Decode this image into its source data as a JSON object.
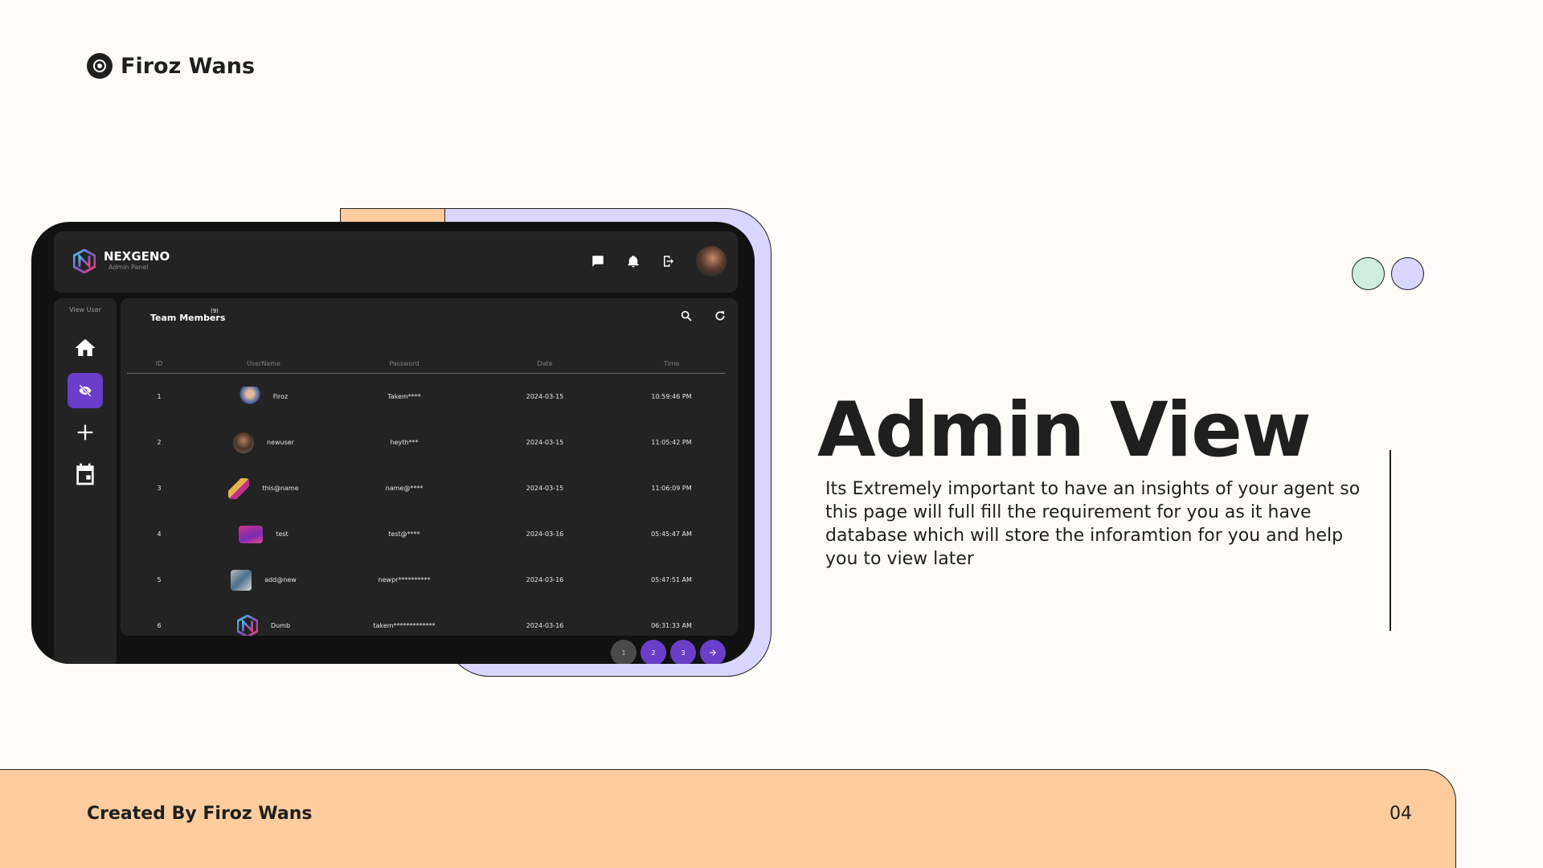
{
  "brand": {
    "name": "Firoz Wans"
  },
  "app": {
    "title": "NEXGENO",
    "subtitle": "Admin Panel",
    "sidebar": {
      "label": "View User"
    },
    "panel": {
      "title": "Team Members",
      "count": "(9)",
      "columns": [
        "ID",
        "UserName",
        "Password",
        "Date",
        "Time"
      ],
      "rows": [
        {
          "id": "1",
          "username": "Firoz",
          "password": "Takem****",
          "date": "2024-03-15",
          "time": "10:59:46 PM"
        },
        {
          "id": "2",
          "username": "newuser",
          "password": "heyth***",
          "date": "2024-03-15",
          "time": "11:05:42 PM"
        },
        {
          "id": "3",
          "username": "this@name",
          "password": "name@****",
          "date": "2024-03-15",
          "time": "11:06:09 PM"
        },
        {
          "id": "4",
          "username": "test",
          "password": "test@****",
          "date": "2024-03-16",
          "time": "05:45:47 AM"
        },
        {
          "id": "5",
          "username": "add@new",
          "password": "newpr**********",
          "date": "2024-03-16",
          "time": "05:47:51 AM"
        },
        {
          "id": "6",
          "username": "Dumb",
          "password": "takem*************",
          "date": "2024-03-16",
          "time": "06:31:33 AM"
        }
      ]
    },
    "pagination": [
      "1",
      "2",
      "3"
    ]
  },
  "slide": {
    "title": "Admin View",
    "description": "Its Extremely important to have an insights of your agent so this page will full fill the requirement for you as it have database which will store the inforamtion for you and help you to view later"
  },
  "footer": {
    "credit": "Created By Firoz Wans",
    "page_number": "04"
  },
  "colors": {
    "accent": "#6a3ec8",
    "footer_bg": "#ffcc9e",
    "lilac": "#d9d7ff",
    "mint": "#cfeedd"
  }
}
